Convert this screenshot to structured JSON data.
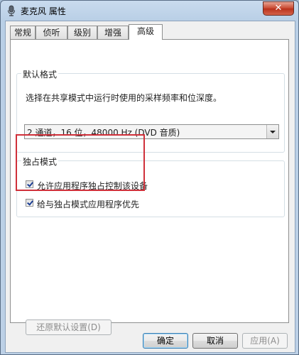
{
  "window": {
    "title": "麦克风 属性",
    "close_label": "✕"
  },
  "tabs": [
    {
      "label": "常规"
    },
    {
      "label": "侦听"
    },
    {
      "label": "级别"
    },
    {
      "label": "增强"
    },
    {
      "label": "高级"
    }
  ],
  "default_format": {
    "title": "默认格式",
    "description": "选择在共享模式中运行时使用的采样频率和位深度。",
    "selected": "2 通道，16 位，48000 Hz (DVD 音质)"
  },
  "exclusive_mode": {
    "title": "独占模式",
    "options": [
      {
        "label": "允许应用程序独占控制该设备",
        "checked": true
      },
      {
        "label": "给与独占模式应用程序优先",
        "checked": true
      }
    ]
  },
  "restore_defaults_label": "还原默认设置(D)",
  "buttons": {
    "ok": "确定",
    "cancel": "取消",
    "apply": "应用(A)"
  },
  "colors": {
    "highlight": "#d0303a",
    "titlebar": "#c9dbee"
  }
}
